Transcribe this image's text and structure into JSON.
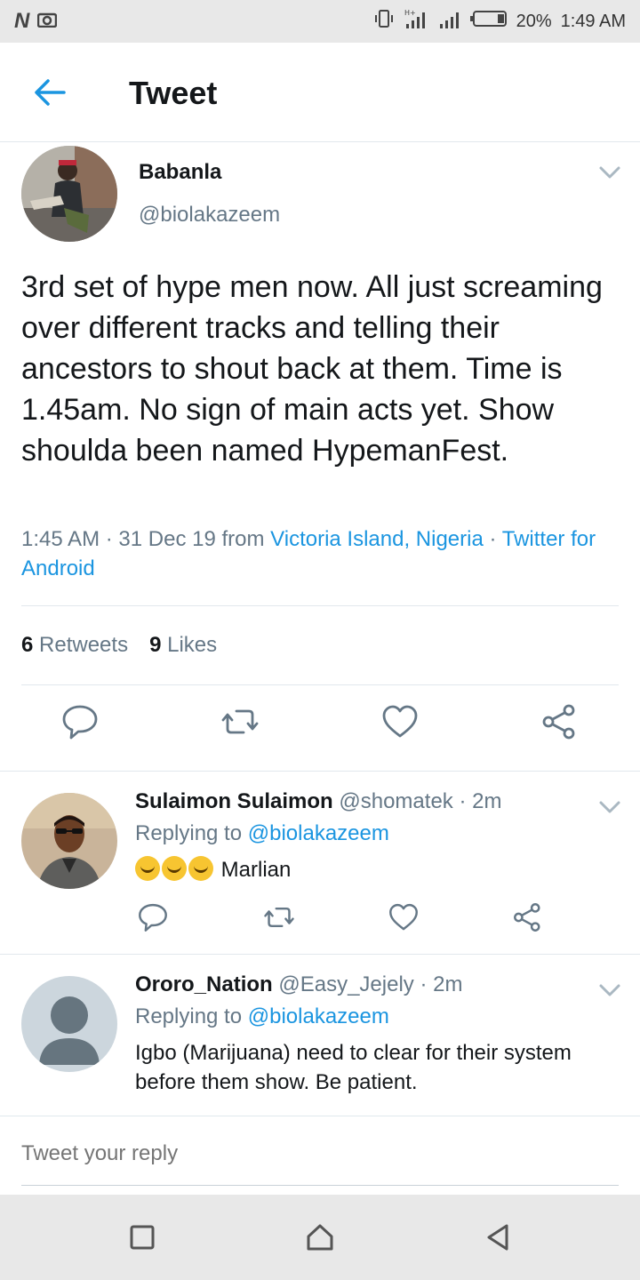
{
  "status_bar": {
    "battery": "20%",
    "time": "1:49 AM",
    "network": "H+"
  },
  "header": {
    "title": "Tweet"
  },
  "main_tweet": {
    "author_name": "Babanla",
    "author_handle": "@biolakazeem",
    "text": "3rd set of hype men now. All just screaming over different tracks and telling their ancestors to shout back at them. Time is 1.45am. No sign of main acts yet. Show shoulda been named HypemanFest.",
    "time": "1:45 AM",
    "date": "31 Dec 19",
    "from_label": "from",
    "location": "Victoria Island, Nigeria",
    "source": "Twitter for Android",
    "retweets_count": "6",
    "retweets_label": "Retweets",
    "likes_count": "9",
    "likes_label": "Likes"
  },
  "replies": [
    {
      "name": "Sulaimon Sulaimon",
      "handle": "@shomatek",
      "time": "2m",
      "replying_label": "Replying to",
      "replying_to": "@biolakazeem",
      "text": "Marlian",
      "emoji_count": 3
    },
    {
      "name": "Ororo_Nation",
      "handle": "@Easy_Jejely",
      "time": "2m",
      "replying_label": "Replying to",
      "replying_to": "@biolakazeem",
      "text": "Igbo (Marijuana) need to clear for their system before them show. Be patient."
    }
  ],
  "composer": {
    "placeholder": "Tweet your reply"
  },
  "colors": {
    "accent": "#1b95e0",
    "text": "#14171a",
    "secondary": "#657786",
    "divider": "#e1e8ed"
  }
}
